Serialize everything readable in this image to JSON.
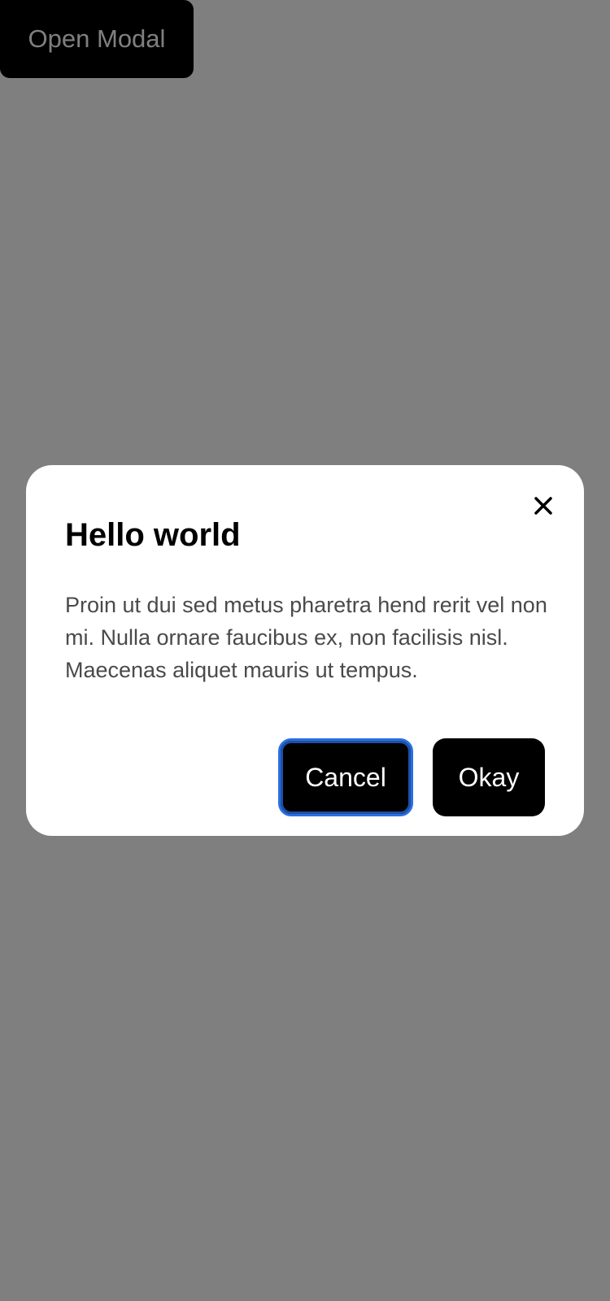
{
  "page": {
    "open_modal_label": "Open Modal"
  },
  "modal": {
    "title": "Hello world",
    "body": "Proin ut dui sed metus pharetra hend rerit vel non mi. Nulla ornare faucibus ex, non facilisis nisl. Maecenas aliquet mauris ut tempus.",
    "close_icon": "close-icon",
    "cancel_label": "Cancel",
    "okay_label": "Okay"
  },
  "colors": {
    "overlay": "#808080",
    "modal_background": "#ffffff",
    "button_background": "#000000",
    "focus_ring": "#2a6fe0",
    "body_text": "#4a4a4a"
  }
}
